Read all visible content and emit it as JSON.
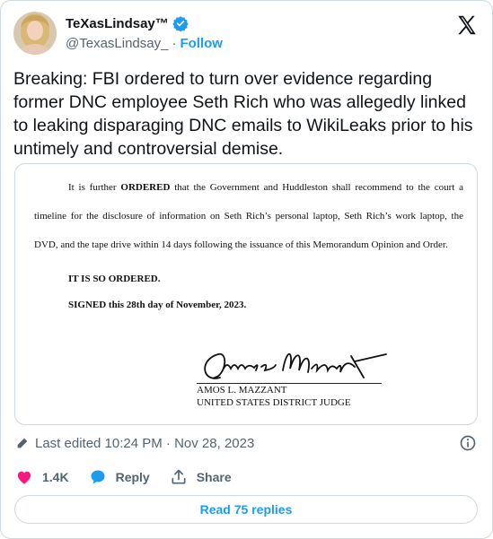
{
  "author": {
    "display_name": "TeXasLindsay™",
    "handle": "@TexasLindsay_",
    "separator": "·",
    "follow_label": "Follow",
    "verified": true
  },
  "tweet": {
    "text": "Breaking: FBI ordered to turn over evidence regarding former DNC employee Seth Rich who was allegedly linked to leaking disparaging DNC emails to WikiLeaks prior to his untimely and controversial demise."
  },
  "document": {
    "para_lead": "It is further ",
    "para_bold": "ORDERED",
    "para_rest": " that the Government and Huddleston shall recommend to the court a timeline for the disclosure of information on Seth Rich’s personal laptop, Seth Rich’s work laptop, the DVD, and the tape drive within 14 days following the issuance of this Memorandum Opinion and Order.",
    "ordered": "IT IS SO ORDERED.",
    "signed": "SIGNED this 28th day of November, 2023.",
    "judge_name": "AMOS L. MAZZANT",
    "judge_title": "UNITED STATES DISTRICT JUDGE"
  },
  "meta": {
    "edited": "Last edited 10:24 PM · Nov 28, 2023"
  },
  "actions": {
    "like_count": "1.4K",
    "reply_label": "Reply",
    "share_label": "Share"
  },
  "read_replies_label": "Read 75 replies",
  "colors": {
    "accent": "#1d9bf0",
    "like": "#f91880",
    "secondary_text": "#536471",
    "border": "#cfd9de"
  },
  "icons": {
    "verified": "verified-badge-icon",
    "x_logo": "x-logo-icon",
    "edited": "pencil-icon",
    "info": "info-icon",
    "like": "heart-icon",
    "reply": "speech-bubble-icon",
    "share": "share-icon"
  }
}
